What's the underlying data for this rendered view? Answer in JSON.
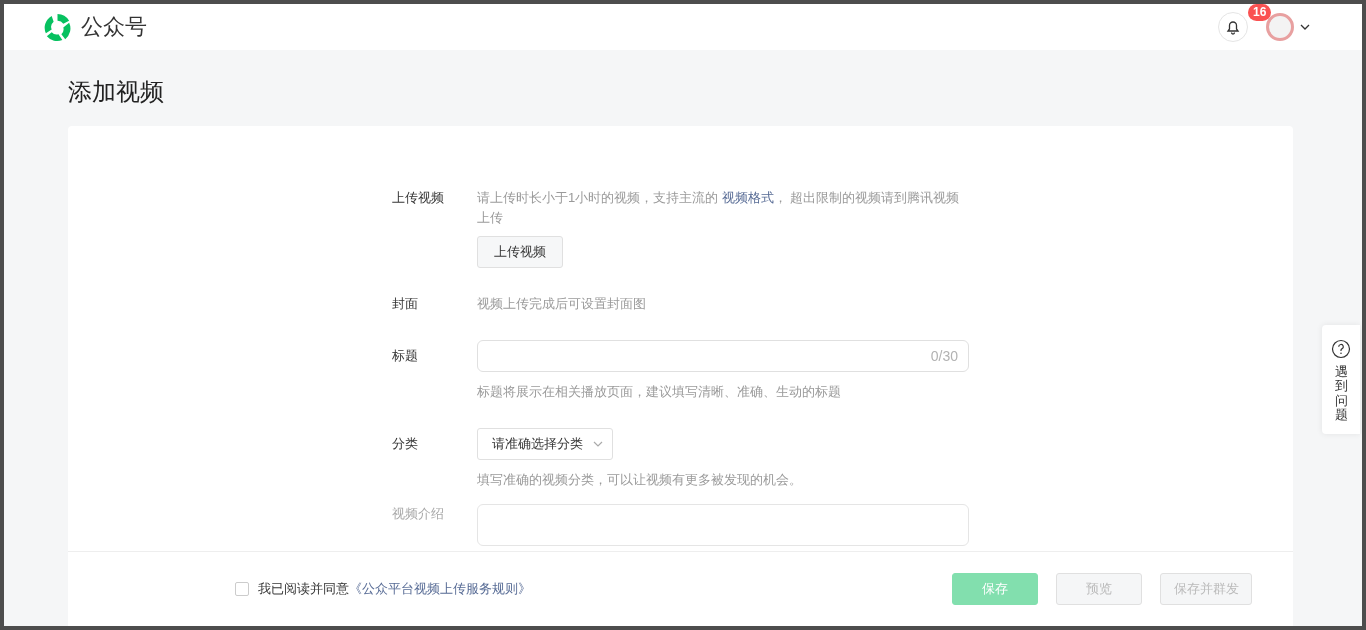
{
  "header": {
    "logo_text": "公众号",
    "notification_count": "16"
  },
  "page_title": "添加视频",
  "form": {
    "rows": [
      {
        "kind": "upload",
        "label": "上传视频",
        "hint_before": "请上传时长小于1小时的视频，支持主流的 ",
        "hint_link": "视频格式",
        "hint_after": "， 超出限制的视频请到腾讯视频上传",
        "button": "上传视频"
      },
      {
        "kind": "text",
        "label": "封面",
        "text": "视频上传完成后可设置封面图"
      },
      {
        "kind": "input",
        "label": "标题",
        "counter": "0/30",
        "hint": "标题将展示在相关播放页面，建议填写清晰、准确、生动的标题"
      },
      {
        "kind": "select",
        "label": "分类",
        "value": "请准确选择分类",
        "hint": "填写准确的视频分类，可以让视频有更多被发现的机会。"
      },
      {
        "kind": "textarea",
        "label": "视频介绍"
      }
    ]
  },
  "footer": {
    "agree": {
      "checked": false,
      "text": "我已阅读并同意",
      "link": "《公众平台视频上传服务规则》"
    },
    "buttons": [
      {
        "label": "保存",
        "kind": "primary",
        "disabled": true
      },
      {
        "label": "预览",
        "kind": "default",
        "disabled": true
      },
      {
        "label": "保存并群发",
        "kind": "default",
        "disabled": true
      }
    ]
  },
  "help": {
    "text": "遇到问题"
  }
}
